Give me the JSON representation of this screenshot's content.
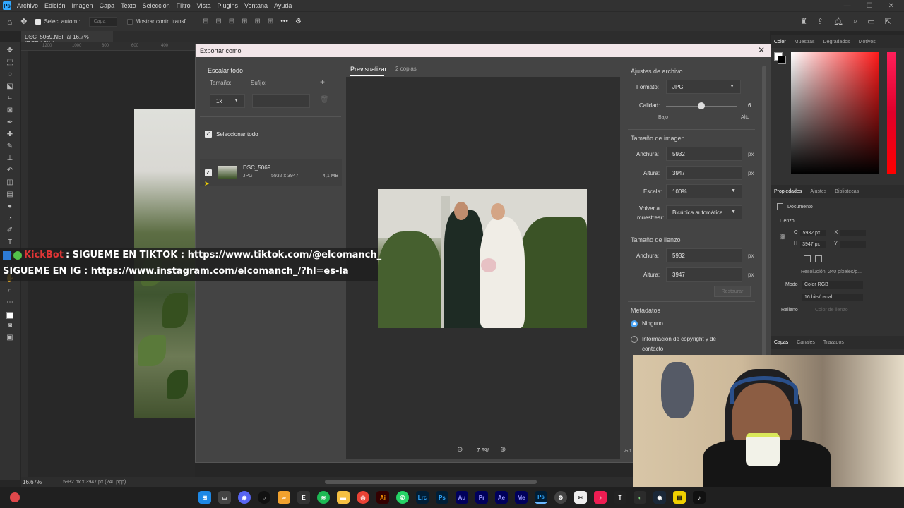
{
  "menubar": {
    "items": [
      "Archivo",
      "Edición",
      "Imagen",
      "Capa",
      "Texto",
      "Selección",
      "Filtro",
      "Vista",
      "Plugins",
      "Ventana",
      "Ayuda"
    ]
  },
  "optionsbar": {
    "auto_select": "Selec. autom.:",
    "layer_select": "Capa",
    "show_transform": "Mostrar contr. transf."
  },
  "document": {
    "tab_title": "DSC_5069.NEF al 16.7% (RGB/16*) *",
    "zoom_status": "16.67%",
    "size_status": "5932 px x 3947 px (240 ppp)"
  },
  "ruler_ticks": [
    "1200",
    "1000",
    "800",
    "600",
    "400"
  ],
  "color_panel": {
    "tabs": [
      "Color",
      "Muestras",
      "Degradados",
      "Motivos"
    ],
    "fg": "#ffffff",
    "bg": "#000000"
  },
  "properties_panel": {
    "tabs": [
      "Propiedades",
      "Ajustes",
      "Bibliotecas"
    ],
    "document_label": "Documento",
    "canvas_label": "Lienzo",
    "w_label": "O",
    "w_value": "5932 px",
    "h_label": "H",
    "h_value": "3947 px",
    "x_label": "X",
    "y_label": "Y",
    "resolution": "Resolución: 240 píxeles/p...",
    "mode_label": "Modo",
    "mode_value": "Color RGB",
    "depth_value": "16 bits/canal",
    "fill_label": "Relleno",
    "fill_value": "Color de lienzo"
  },
  "layers_panel": {
    "tabs": [
      "Capas",
      "Canales",
      "Trazados"
    ]
  },
  "dialog": {
    "title": "Exportar como",
    "left": {
      "scale_all": "Escalar todo",
      "size_label": "Tamaño:",
      "suffix_label": "Sufijo:",
      "size_value": "1x",
      "select_all": "Seleccionar todo",
      "asset_name": "DSC_5069",
      "asset_format": "JPG",
      "asset_dims": "5932 x 3947",
      "asset_size": "4,1 MB"
    },
    "preview": {
      "tab_preview": "Previsualizar",
      "tab_copies": "2 copias",
      "zoom": "7.5%"
    },
    "right": {
      "file_settings": "Ajustes de archivo",
      "format_label": "Formato:",
      "format_value": "JPG",
      "quality_label": "Calidad:",
      "quality_value": "6",
      "quality_fraction": 0.5,
      "quality_low": "Bajo",
      "quality_high": "Alto",
      "image_size": "Tamaño de imagen",
      "width_label": "Anchura:",
      "width_value": "5932",
      "height_label": "Altura:",
      "height_value": "3947",
      "unit": "px",
      "scale_label": "Escala:",
      "scale_value": "100%",
      "resample_label_1": "Volver a",
      "resample_label_2": "muestrear:",
      "resample_value": "Bicúbica automática",
      "canvas_size": "Tamaño de lienzo",
      "canvas_width_label": "Anchura:",
      "canvas_width_value": "5932",
      "canvas_height_label": "Altura:",
      "canvas_height_value": "3947",
      "restore": "Restaurar",
      "metadata": "Metadatos",
      "meta_none": "Ninguno",
      "meta_copyright_1": "Información de copyright y de",
      "meta_copyright_2": "contacto",
      "version": "v5.1"
    }
  },
  "bot_overlay": {
    "bot_name": "KickBot",
    "line1": ": SIGUEME EN TIKTOK : https://www.tiktok.com/@elcomanch_",
    "line2": "SIGUEME EN IG : https://www.instagram.com/elcomanch_/?hl=es-la"
  },
  "taskbar": {
    "apps": [
      "Ai",
      "Lrc",
      "Ps",
      "Au",
      "Pr",
      "Ae",
      "Me",
      "Ps"
    ]
  }
}
